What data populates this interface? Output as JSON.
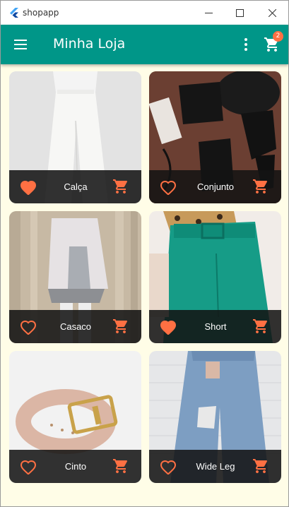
{
  "window": {
    "title": "shopapp"
  },
  "appbar": {
    "title": "Minha Loja",
    "cart_count": "2"
  },
  "colors": {
    "primary": "#009688",
    "accent": "#ff7043",
    "background": "#fffde7"
  },
  "products": [
    {
      "name": "Calça",
      "favorite": true
    },
    {
      "name": "Conjunto",
      "favorite": false
    },
    {
      "name": "Casaco",
      "favorite": false
    },
    {
      "name": "Short",
      "favorite": true
    },
    {
      "name": "Cinto",
      "favorite": false
    },
    {
      "name": "Wide Leg",
      "favorite": false
    }
  ]
}
